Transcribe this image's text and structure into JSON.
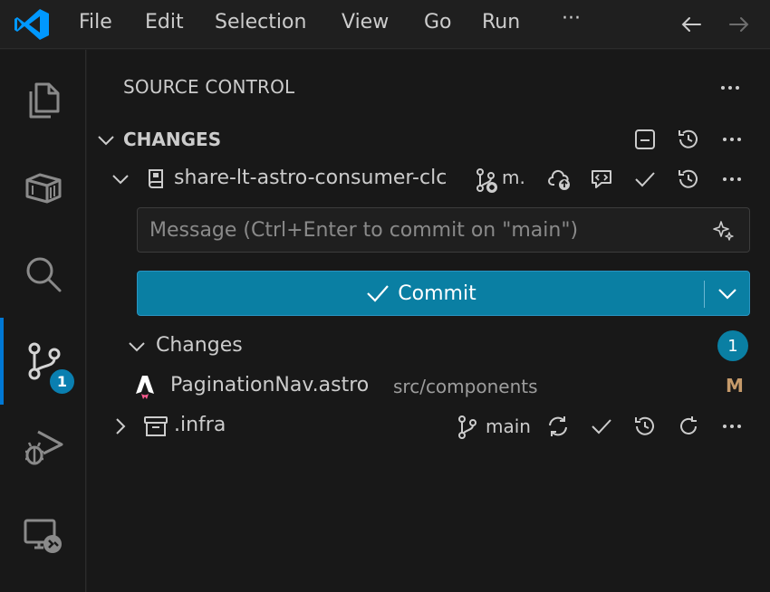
{
  "menu": {
    "items": [
      "File",
      "Edit",
      "Selection",
      "View",
      "Go",
      "Run"
    ],
    "more": "···"
  },
  "activity_bar": {
    "scm_badge": "1"
  },
  "panel": {
    "title": "SOURCE CONTROL",
    "section_title": "CHANGES",
    "repo1": {
      "name": "share-lt-astro-consumer-clc",
      "branch": "m."
    },
    "commit_input": {
      "placeholder": "Message (Ctrl+Enter to commit on \"main\")",
      "value": ""
    },
    "commit_button": {
      "label": "Commit"
    },
    "changes_group": {
      "label": "Changes",
      "count": "1"
    },
    "file": {
      "name": "PaginationNav.astro",
      "path": "src/components",
      "status": "M",
      "status_color": "#c59a6a"
    },
    "repo2": {
      "name": ".infra",
      "branch": "main"
    }
  },
  "colors": {
    "accent": "#0078d4",
    "commit_button": "#0a7fa3",
    "badge": "#0a7fb0"
  }
}
